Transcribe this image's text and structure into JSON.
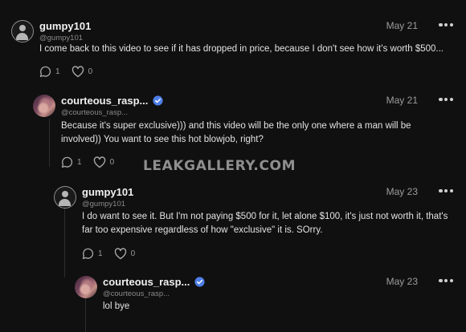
{
  "comments": [
    {
      "username": "gumpy101",
      "handle": "@gumpy101",
      "date": "May 21",
      "text": "I come back to this video to see if it has dropped in price, because I don't see how it's worth $500...",
      "reply_count": "1",
      "like_count": "0",
      "verified": false
    },
    {
      "username": "courteous_rasp...",
      "handle": "@courteous_rasp...",
      "date": "May 21",
      "text": "Because it's super exclusive))) and this video will be the only one where a man will be involved)) You want to see this hot blowjob, right?",
      "reply_count": "1",
      "like_count": "0",
      "verified": true
    },
    {
      "username": "gumpy101",
      "handle": "@gumpy101",
      "date": "May 23",
      "text": "I do want to see it. But I'm not paying $500 for it, let alone $100, it's just not worth it, that's far too expensive regardless of how \"exclusive\" it is. SOrry.",
      "reply_count": "1",
      "like_count": "0",
      "verified": false
    },
    {
      "username": "courteous_rasp...",
      "handle": "@courteous_rasp...",
      "date": "May 23",
      "text": "lol bye",
      "verified": true
    }
  ],
  "watermark": "LEAKGALLERY.COM",
  "colors": {
    "background": "#101010",
    "verified_badge": "#4f7fe8",
    "muted_text": "#9c9c9c"
  },
  "icons": {
    "reply": "speech-bubble-icon",
    "like": "heart-icon",
    "more": "three-dots-icon",
    "verified": "verified-badge-icon"
  }
}
